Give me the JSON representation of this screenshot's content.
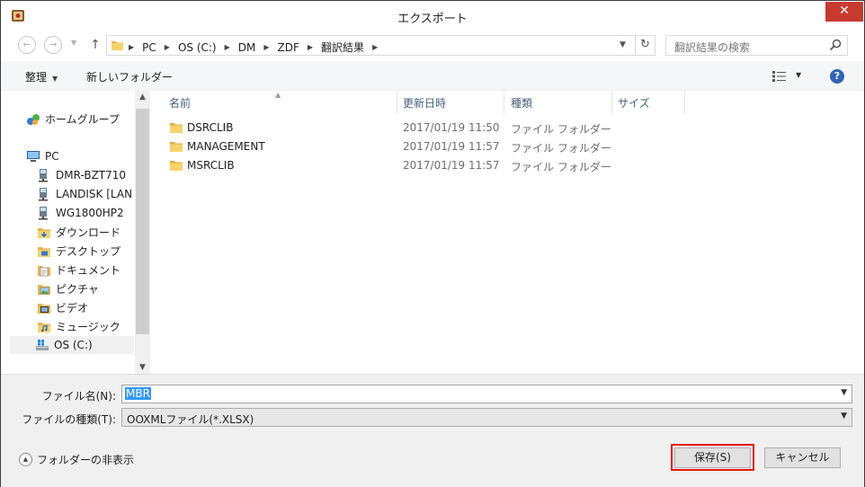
{
  "window": {
    "title": "エクスポート",
    "close_glyph": "✕"
  },
  "nav": {
    "back_glyph": "←",
    "forward_glyph": "→",
    "up_glyph": "↑",
    "refresh_glyph": "↻"
  },
  "address": {
    "crumbs": [
      "PC",
      "OS (C:)",
      "DM",
      "ZDF",
      "翻訳結果"
    ]
  },
  "search": {
    "placeholder": "翻訳結果の検索"
  },
  "toolbar": {
    "organize_label": "整理",
    "new_folder_label": "新しいフォルダー",
    "help_glyph": "?"
  },
  "sidebar": {
    "items": [
      {
        "label": "ホームグループ",
        "icon": "homegroup-icon"
      },
      {
        "label": "PC",
        "icon": "computer-icon"
      },
      {
        "label": "DMR-BZT710",
        "icon": "network-drive-icon"
      },
      {
        "label": "LANDISK [LAN",
        "icon": "network-drive-icon"
      },
      {
        "label": "WG1800HP2",
        "icon": "network-drive-icon"
      },
      {
        "label": "ダウンロード",
        "icon": "downloads-folder-icon"
      },
      {
        "label": "デスクトップ",
        "icon": "desktop-folder-icon"
      },
      {
        "label": "ドキュメント",
        "icon": "documents-folder-icon"
      },
      {
        "label": "ピクチャ",
        "icon": "pictures-folder-icon"
      },
      {
        "label": "ビデオ",
        "icon": "videos-folder-icon"
      },
      {
        "label": "ミュージック",
        "icon": "music-folder-icon"
      },
      {
        "label": "OS (C:)",
        "icon": "drive-icon"
      }
    ]
  },
  "filelist": {
    "columns": [
      "名前",
      "更新日時",
      "種類",
      "サイズ"
    ],
    "rows": [
      {
        "name": "DSRCLIB",
        "date": "2017/01/19 11:50",
        "type": "ファイル フォルダー"
      },
      {
        "name": "MANAGEMENT",
        "date": "2017/01/19 11:57",
        "type": "ファイル フォルダー"
      },
      {
        "name": "MSRCLIB",
        "date": "2017/01/19 11:57",
        "type": "ファイル フォルダー"
      }
    ]
  },
  "form": {
    "filename_label": "ファイル名(N):",
    "filename_value": "MBR",
    "filetype_label": "ファイルの種類(T):",
    "filetype_value": "OOXMLファイル(*.XLSX)"
  },
  "footer": {
    "hide_folders_label": "フォルダーの非表示",
    "save_label": "保存(S)",
    "cancel_label": "キャンセル"
  },
  "colors": {
    "accent": "#e31414",
    "selection": "#3399ff",
    "close": "#c73a2e"
  }
}
